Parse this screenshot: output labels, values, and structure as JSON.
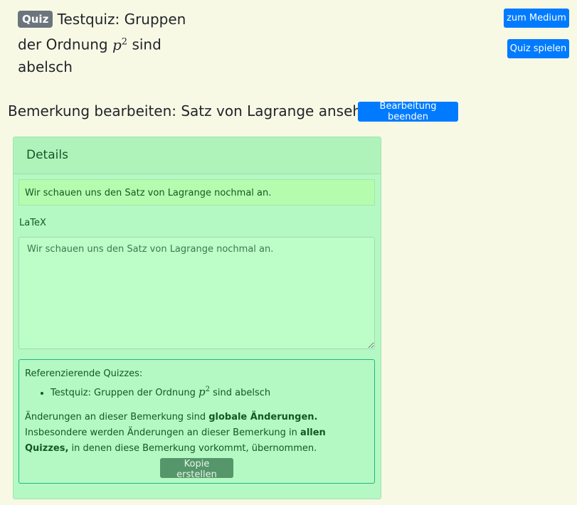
{
  "header": {
    "badge": "Quiz",
    "title_part1": "Testquiz: Gruppen der Ordnung",
    "title_math": "p",
    "title_sup": "2",
    "title_part2": "sind abelsch",
    "zum_medium": "zum Medium",
    "quiz_spielen": "Quiz spielen"
  },
  "edit": {
    "heading": "Bemerkung bearbeiten: Satz von Lagrange ansehen",
    "end_button": "Bearbeitung beenden"
  },
  "card": {
    "header": "Details",
    "preview": "Wir schauen uns den Satz von Lagrange nochmal an.",
    "latex_label": "LaTeX",
    "latex_value": "Wir schauen uns den Satz von Lagrange nochmal an.",
    "info": {
      "ref_label": "Referenzierende Quizzes:",
      "ref_items": [
        {
          "part1": "Testquiz: Gruppen der Ordnung",
          "math": "p",
          "sup": "2",
          "part2": "sind abelsch"
        }
      ],
      "text1": "Änderungen an dieser Bemerkung sind ",
      "bold1": "globale Änderungen.",
      "text2": " Insbesondere werden Änderungen an dieser Bemerkung in ",
      "bold2": "allen Quizzes,",
      "text3": " in denen diese Bemerkung vorkommt, übernommen.",
      "copy_button": "Kopie erstellen"
    }
  }
}
